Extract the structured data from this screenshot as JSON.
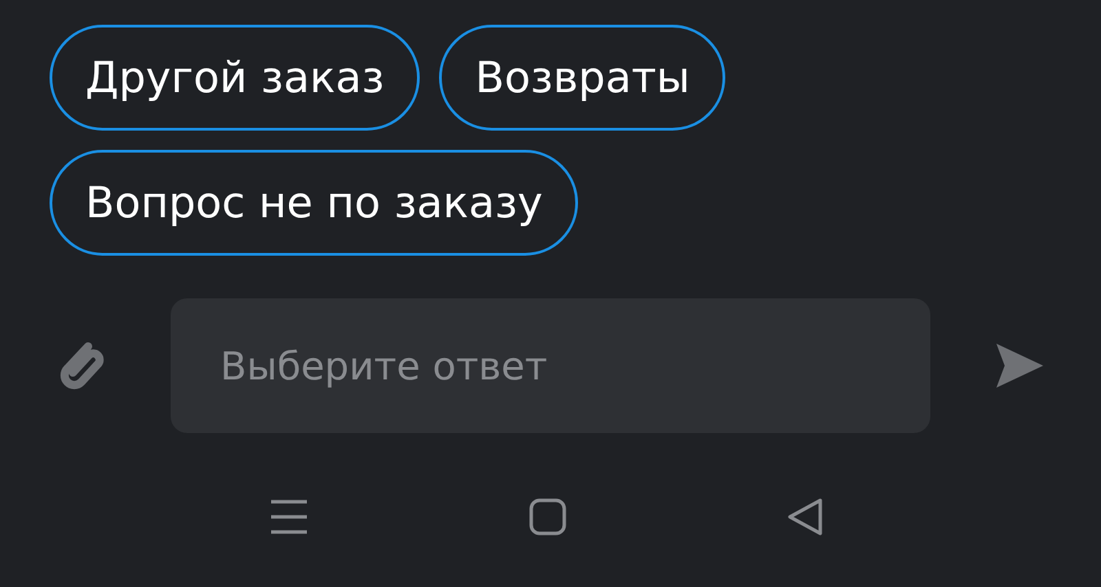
{
  "quick_replies": [
    {
      "label": "Другой заказ"
    },
    {
      "label": "Возвраты"
    },
    {
      "label": "Вопрос не по заказу"
    }
  ],
  "composer": {
    "placeholder": "Выберите ответ"
  }
}
